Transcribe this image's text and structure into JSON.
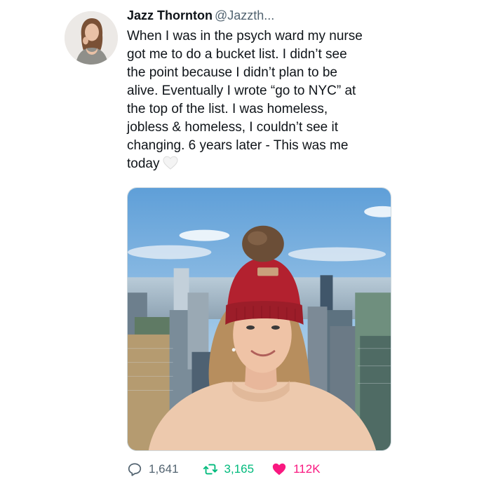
{
  "tweet": {
    "author": {
      "display_name": "Jazz Thornton",
      "handle": "@Jazzth..."
    },
    "text_lines": [
      "When I was in the psych ward my nurse",
      "got me to do a bucket list. I didn’t see",
      "the point because I didn’t plan to be",
      "alive. Eventually I wrote “go to NYC” at",
      "the top of the list. I was homeless,",
      "jobless & homeless, I couldn’t see it",
      "changing. 6 years later - This was me",
      "today"
    ],
    "emoji": "white-heart-emoji",
    "media": {
      "type": "photo",
      "subject": "selfie-city-skyline"
    },
    "stats": {
      "replies": "1,641",
      "retweets": "3,165",
      "likes": "112K"
    }
  },
  "icons": {
    "reply": "speech-bubble-icon",
    "retweet": "retweet-arrows-icon",
    "like": "filled-heart-icon"
  },
  "colors": {
    "text": "#0f1419",
    "secondary": "#536471",
    "retweet": "#00ba7c",
    "like": "#f91880"
  }
}
